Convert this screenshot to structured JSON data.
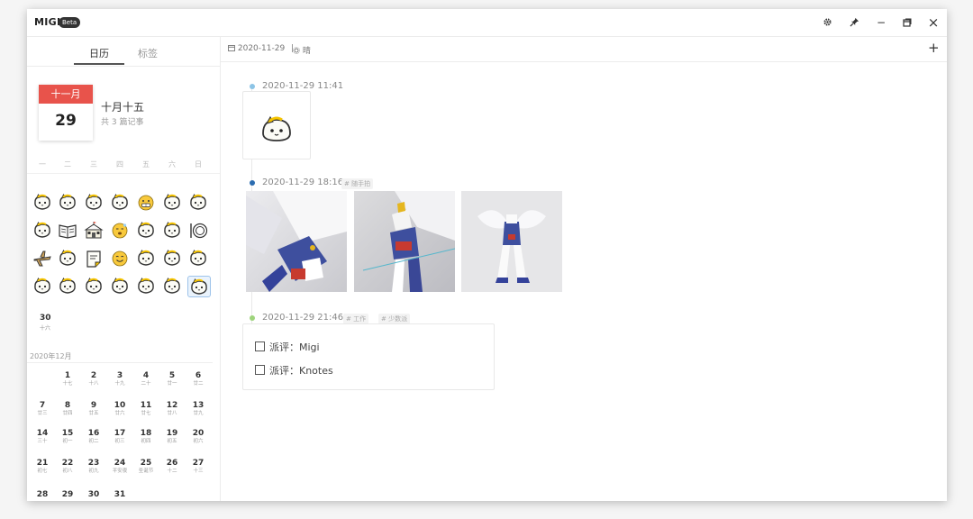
{
  "app": {
    "name": "MIGI",
    "badge": "Beta"
  },
  "window_controls": {
    "settings": "✿",
    "pin": "✦",
    "minimize": "−",
    "restore": "⧉",
    "close": "×"
  },
  "sidebar": {
    "tabs": [
      {
        "label": "日历",
        "active": true
      },
      {
        "label": "标签",
        "active": false
      }
    ],
    "date_card": {
      "month": "十一月",
      "day": "29",
      "lunar": "十月十五",
      "count": "共 3 篇记事"
    },
    "weekdays": [
      "一",
      "二",
      "三",
      "四",
      "五",
      "六",
      "日"
    ],
    "mood_rows": [
      [
        "cat-face-icon",
        "cat-face-icon",
        "cat-face-icon",
        "cat-face-icon",
        "grimace-face-icon",
        "cat-face-icon",
        "cat-face-icon"
      ],
      [
        "cat-face-icon",
        "book-icon",
        "school-icon",
        "sleepy-face-icon",
        "cat-face-icon",
        "cat-face-icon",
        "plate-icon"
      ],
      [
        "airplane-icon",
        "cat-face-icon",
        "note-icon",
        "smile-face-icon",
        "cat-face-icon",
        "cat-face-icon",
        "cat-face-icon"
      ],
      [
        "cat-face-icon",
        "cat-face-icon",
        "cat-face-icon",
        "cat-face-icon",
        "cat-face-icon",
        "cat-face-icon",
        "cat-face-icon"
      ]
    ],
    "selected_day": 29,
    "day30": {
      "num": "30",
      "lunar": "十六"
    },
    "next_month_label": "2020年12月",
    "december": [
      [
        null,
        {
          "n": "1",
          "l": "十七"
        },
        {
          "n": "2",
          "l": "十八"
        },
        {
          "n": "3",
          "l": "十九"
        },
        {
          "n": "4",
          "l": "二十"
        },
        {
          "n": "5",
          "l": "廿一"
        },
        {
          "n": "6",
          "l": "廿二"
        }
      ],
      [
        {
          "n": "7",
          "l": "廿三"
        },
        {
          "n": "8",
          "l": "廿四"
        },
        {
          "n": "9",
          "l": "廿五"
        },
        {
          "n": "10",
          "l": "廿六"
        },
        {
          "n": "11",
          "l": "廿七"
        },
        {
          "n": "12",
          "l": "廿八"
        },
        {
          "n": "13",
          "l": "廿九"
        }
      ],
      [
        {
          "n": "14",
          "l": "三十"
        },
        {
          "n": "15",
          "l": "初一"
        },
        {
          "n": "16",
          "l": "初二"
        },
        {
          "n": "17",
          "l": "初三"
        },
        {
          "n": "18",
          "l": "初四"
        },
        {
          "n": "19",
          "l": "初五"
        },
        {
          "n": "20",
          "l": "初六"
        }
      ],
      [
        {
          "n": "21",
          "l": "初七"
        },
        {
          "n": "22",
          "l": "初八"
        },
        {
          "n": "23",
          "l": "初九"
        },
        {
          "n": "24",
          "l": "平安夜"
        },
        {
          "n": "25",
          "l": "圣诞节"
        },
        {
          "n": "26",
          "l": "十二"
        },
        {
          "n": "27",
          "l": "十三"
        }
      ],
      [
        {
          "n": "28",
          "l": ""
        },
        {
          "n": "29",
          "l": ""
        },
        {
          "n": "30",
          "l": ""
        },
        {
          "n": "31",
          "l": ""
        },
        null,
        null,
        null
      ]
    ]
  },
  "header": {
    "date": "2020-11-29",
    "separator": "|",
    "weather": "晴",
    "add": "+"
  },
  "entries": [
    {
      "time": "2020-11-29 11:41",
      "tags": [],
      "dot_color": "#8cc4e6"
    },
    {
      "time": "2020-11-29 18:16",
      "tags": [
        "# 随手拍"
      ],
      "dot_color": "#2b6cb0"
    },
    {
      "time": "2020-11-29 21:46",
      "tags": [
        "# 工作",
        "# 少数派"
      ],
      "dot_color": "#9ed47c"
    }
  ],
  "todos": [
    {
      "label": "派评：Migi",
      "checked": false
    },
    {
      "label": "派评：Knotes",
      "checked": false
    }
  ]
}
